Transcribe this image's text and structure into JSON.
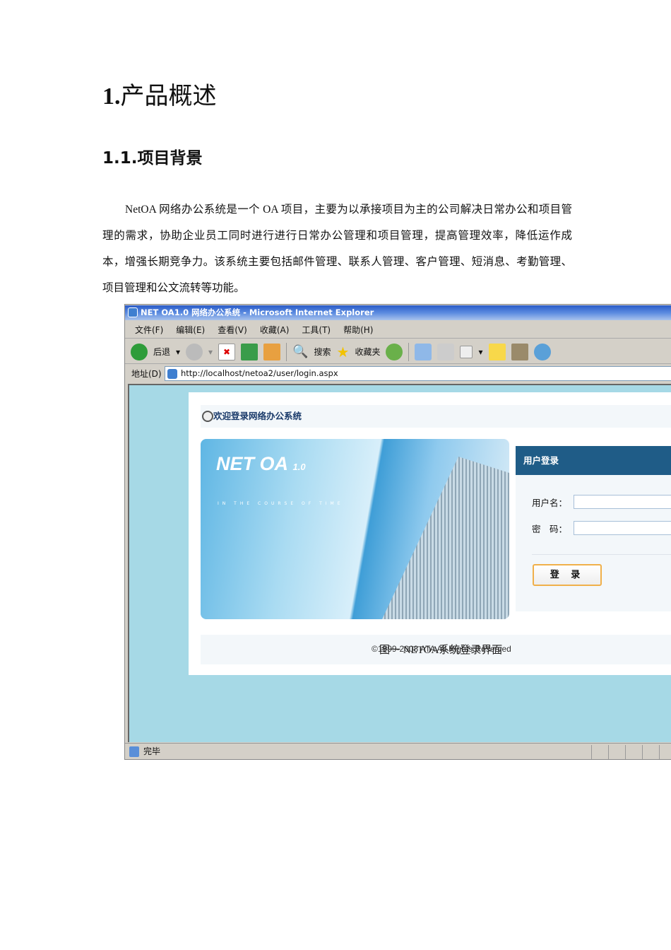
{
  "heading1": {
    "number": "1.",
    "text": "产品概述"
  },
  "heading2": {
    "number": "1.1.",
    "text": "项目背景"
  },
  "paragraph": "NetOA 网络办公系统是一个 OA 项目，主要为以承接项目为主的公司解决日常办公和项目管理的需求，协助企业员工同时进行进行日常办公管理和项目管理，提高管理效率，降低运作成本，增强长期竞争力。该系统主要包括邮件管理、联系人管理、客户管理、短消息、考勤管理、项目管理和公文流转等功能。",
  "browser": {
    "title": "NET OA1.0 网络办公系统 - Microsoft Internet Explorer",
    "menu": [
      "文件(F)",
      "编辑(E)",
      "查看(V)",
      "收藏(A)",
      "工具(T)",
      "帮助(H)"
    ],
    "toolbar": {
      "back": "后退",
      "search": "搜索",
      "favorites": "收藏夹"
    },
    "address_label": "地址(D)",
    "url": "http://localhost/netoa2/user/login.aspx",
    "status": "完毕"
  },
  "page": {
    "welcome": "欢迎登录网络办公系统",
    "logo": "NET OA",
    "version": "1.0",
    "tagline": "IN THE COURSE OF TIME",
    "login_title": "用户登录",
    "username_label": "用户名：",
    "password_label": "密　码：",
    "username_value": "",
    "password_value": "",
    "login_button": "登 录",
    "copyright": "©1999-2008 ATA All Rights Reserved"
  },
  "caption": "图一  NETOA系统登录界面",
  "colors": {
    "content_bg": "#a6d9e6",
    "login_header": "#1f5c87"
  }
}
